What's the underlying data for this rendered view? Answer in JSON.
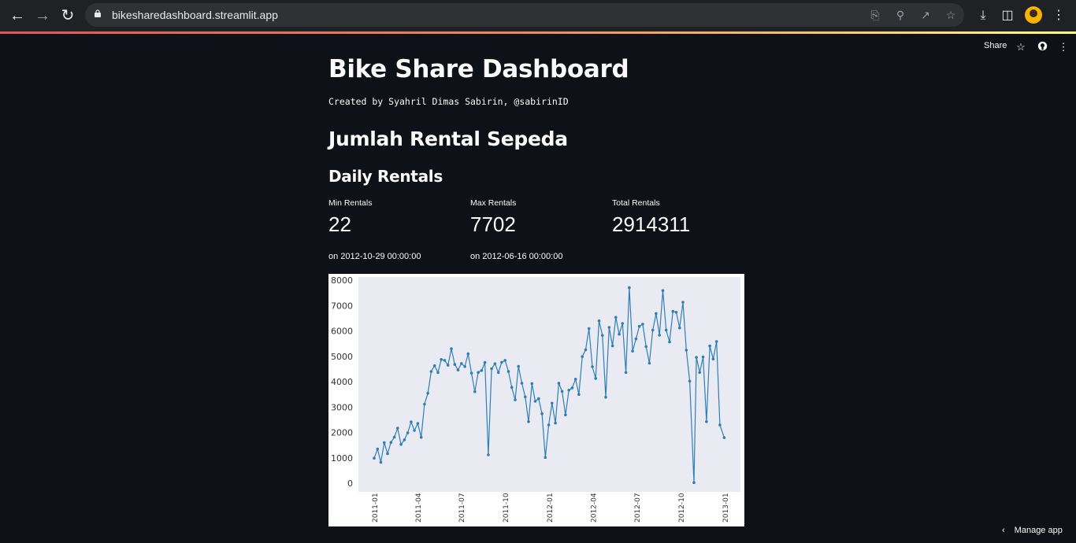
{
  "browser": {
    "url": "bikesharedashboard.streamlit.app"
  },
  "streamlit_header": {
    "share_label": "Share"
  },
  "page": {
    "title": "Bike Share Dashboard",
    "byline": "Created by Syahril Dimas Sabirin, @sabirinID",
    "section_heading": "Jumlah Rental Sepeda",
    "subsection_heading": "Daily Rentals"
  },
  "metrics": [
    {
      "label": "Min Rentals",
      "value": "22",
      "note": "on 2012-10-29 00:00:00"
    },
    {
      "label": "Max Rentals",
      "value": "7702",
      "note": "on 2012-06-16 00:00:00"
    },
    {
      "label": "Total Rentals",
      "value": "2914311",
      "note": ""
    }
  ],
  "footer": {
    "manage_label": "Manage app"
  },
  "colors": {
    "app_bg": "#0e1117",
    "plot_bg": "#eaeaf2",
    "line": "#2f7fb5"
  },
  "chart_data": {
    "type": "line",
    "title": "",
    "xlabel": "",
    "ylabel": "",
    "ylim": [
      0,
      8000
    ],
    "y_ticks": [
      0,
      1000,
      2000,
      3000,
      4000,
      5000,
      6000,
      7000,
      8000
    ],
    "x_ticks": [
      "2011-01",
      "2011-04",
      "2011-07",
      "2011-10",
      "2012-01",
      "2012-04",
      "2012-07",
      "2012-10",
      "2013-01"
    ],
    "markers": true,
    "grid": false,
    "series": [
      {
        "x": [
          "2011-01-01",
          "2011-01-08",
          "2011-01-15",
          "2011-01-22",
          "2011-01-29",
          "2011-02-05",
          "2011-02-12",
          "2011-02-19",
          "2011-02-26",
          "2011-03-05",
          "2011-03-12",
          "2011-03-19",
          "2011-03-26",
          "2011-04-02",
          "2011-04-09",
          "2011-04-16",
          "2011-04-23",
          "2011-04-30",
          "2011-05-07",
          "2011-05-14",
          "2011-05-21",
          "2011-05-28",
          "2011-06-04",
          "2011-06-11",
          "2011-06-18",
          "2011-06-25",
          "2011-07-02",
          "2011-07-09",
          "2011-07-16",
          "2011-07-23",
          "2011-07-30",
          "2011-08-06",
          "2011-08-13",
          "2011-08-20",
          "2011-08-27",
          "2011-09-03",
          "2011-09-10",
          "2011-09-17",
          "2011-09-24",
          "2011-10-01",
          "2011-10-08",
          "2011-10-15",
          "2011-10-22",
          "2011-10-29",
          "2011-11-05",
          "2011-11-12",
          "2011-11-19",
          "2011-11-26",
          "2011-12-03",
          "2011-12-10",
          "2011-12-17",
          "2011-12-24",
          "2011-12-31",
          "2012-01-07",
          "2012-01-14",
          "2012-01-21",
          "2012-01-28",
          "2012-02-04",
          "2012-02-11",
          "2012-02-18",
          "2012-02-25",
          "2012-03-03",
          "2012-03-10",
          "2012-03-17",
          "2012-03-24",
          "2012-03-31",
          "2012-04-07",
          "2012-04-14",
          "2012-04-21",
          "2012-04-28",
          "2012-05-05",
          "2012-05-12",
          "2012-05-19",
          "2012-05-26",
          "2012-06-02",
          "2012-06-09",
          "2012-06-16",
          "2012-06-23",
          "2012-06-30",
          "2012-07-07",
          "2012-07-14",
          "2012-07-21",
          "2012-07-28",
          "2012-08-04",
          "2012-08-11",
          "2012-08-18",
          "2012-08-25",
          "2012-09-01",
          "2012-09-08",
          "2012-09-15",
          "2012-09-22",
          "2012-09-29",
          "2012-10-06",
          "2012-10-13",
          "2012-10-20",
          "2012-10-29",
          "2012-11-03",
          "2012-11-10",
          "2012-11-17",
          "2012-11-24",
          "2012-12-01",
          "2012-12-08",
          "2012-12-15",
          "2012-12-22",
          "2012-12-31"
        ],
        "values": [
          985,
          1349,
          822,
          1600,
          1162,
          1605,
          1815,
          2169,
          1530,
          1708,
          1983,
          2416,
          2076,
          2355,
          1807,
          3115,
          3544,
          4400,
          4628,
          4360,
          4873,
          4839,
          4648,
          5298,
          4679,
          4459,
          4716,
          4595,
          5099,
          4338,
          3606,
          4367,
          4441,
          4757,
          1115,
          4511,
          4708,
          4362,
          4763,
          4839,
          4400,
          3777,
          3285,
          4604,
          3940,
          3403,
          2425,
          3926,
          3228,
          3331,
          2739,
          1013,
          2294,
          3154,
          2368,
          3940,
          3619,
          2693,
          3666,
          3755,
          4099,
          3497,
          4990,
          5259,
          6093,
          4590,
          4126,
          6398,
          5823,
          3387,
          6140,
          5409,
          6536,
          5870,
          6296,
          4362,
          7702,
          5204,
          5687,
          6179,
          6267,
          5382,
          4729,
          6031,
          6685,
          5834,
          7591,
          6033,
          5567,
          6770,
          6734,
          6118,
          7132,
          5243,
          4023,
          22,
          4959,
          4363,
          4975,
          2424,
          5409,
          4893,
          5582,
          2294,
          1796
        ]
      }
    ]
  }
}
